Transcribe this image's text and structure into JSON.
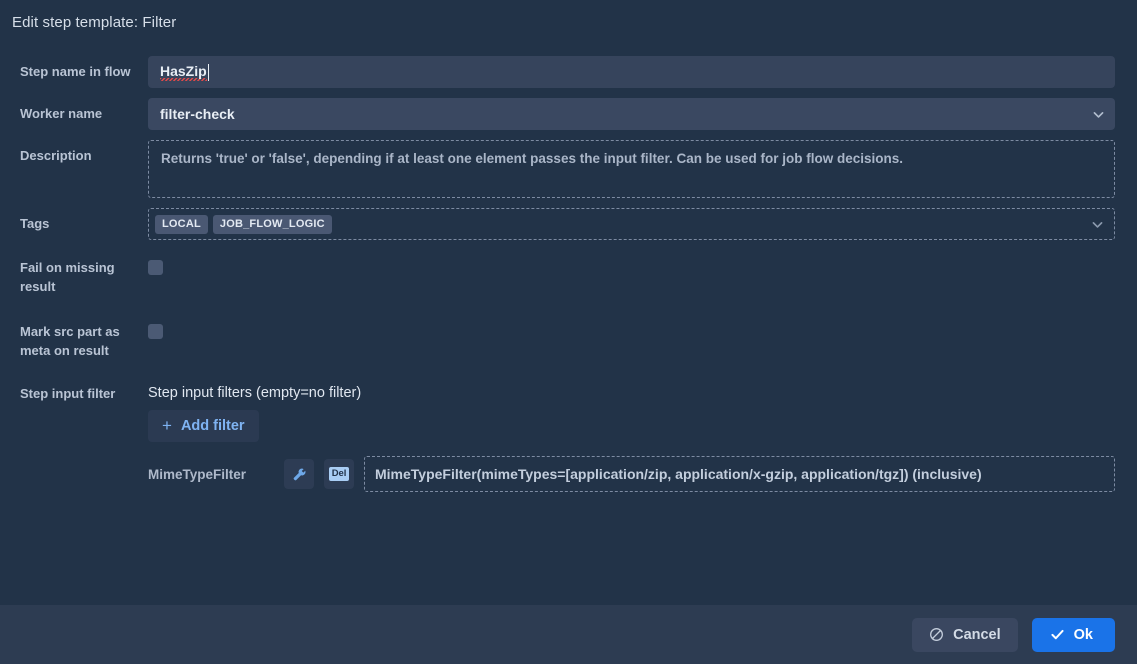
{
  "dialog": {
    "title": "Edit step template: Filter"
  },
  "fields": {
    "step_name": {
      "label": "Step name in flow",
      "value": "HasZip"
    },
    "worker_name": {
      "label": "Worker name",
      "value": "filter-check",
      "chevron_icon": "chevron-down-icon"
    },
    "description": {
      "label": "Description",
      "value": "Returns 'true' or 'false', depending if at least one element passes the input filter. Can be used for job flow decisions."
    },
    "tags": {
      "label": "Tags",
      "values": [
        "LOCAL",
        "JOB_FLOW_LOGIC"
      ],
      "chevron_icon": "chevron-down-icon"
    },
    "fail_on_missing": {
      "label": "Fail on missing result",
      "checked": false
    },
    "mark_src_meta": {
      "label": "Mark src part as meta on result",
      "checked": false
    },
    "step_input_filter": {
      "label": "Step input filter",
      "heading": "Step input filters (empty=no filter)",
      "add_button": {
        "label": "Add filter",
        "icon": "plus-icon"
      },
      "filters": [
        {
          "name": "MimeTypeFilter",
          "config_icon": "wrench-icon",
          "delete_icon": "del-icon",
          "delete_label": "Del",
          "value": "MimeTypeFilter(mimeTypes=[application/zip, application/x-gzip, application/tgz]) (inclusive)"
        }
      ]
    }
  },
  "footer": {
    "cancel": {
      "label": "Cancel",
      "icon": "ban-icon"
    },
    "ok": {
      "label": "Ok",
      "icon": "check-icon"
    }
  },
  "colors": {
    "background": "#223348",
    "footer_background": "#2d3c52",
    "accent_blue": "#1a73e8",
    "link_blue": "#7fb3f2",
    "spellcheck_red": "#e04a4a"
  }
}
